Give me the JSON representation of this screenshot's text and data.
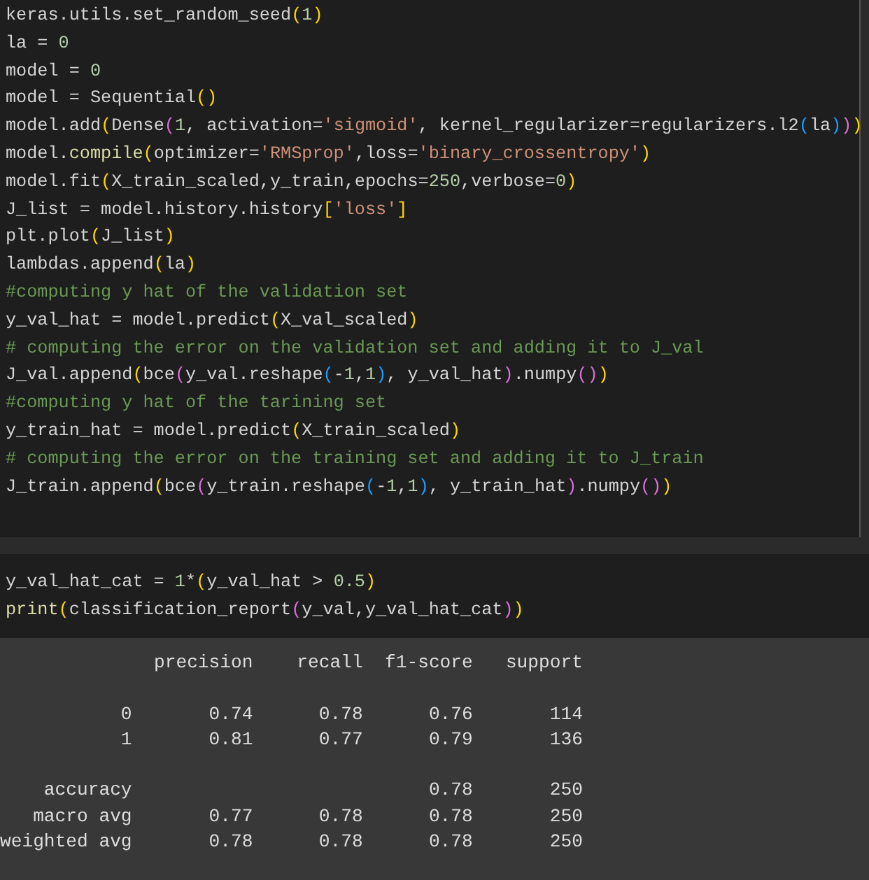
{
  "cells": [
    {
      "lines": [
        [
          {
            "kind": "plain",
            "text": "keras.utils.set_random_seed"
          },
          {
            "kind": "br1",
            "text": "("
          },
          {
            "kind": "num",
            "text": "1"
          },
          {
            "kind": "br1",
            "text": ")"
          }
        ],
        [
          {
            "kind": "plain",
            "text": "la = "
          },
          {
            "kind": "num",
            "text": "0"
          }
        ],
        [
          {
            "kind": "plain",
            "text": "model = "
          },
          {
            "kind": "num",
            "text": "0"
          }
        ],
        [
          {
            "kind": "plain",
            "text": "model = Sequential"
          },
          {
            "kind": "br1",
            "text": "()"
          }
        ],
        [
          {
            "kind": "plain",
            "text": "model.add"
          },
          {
            "kind": "br1",
            "text": "("
          },
          {
            "kind": "plain",
            "text": "Dense"
          },
          {
            "kind": "br2",
            "text": "("
          },
          {
            "kind": "num",
            "text": "1"
          },
          {
            "kind": "plain",
            "text": ", activation="
          },
          {
            "kind": "str",
            "text": "'sigmoid'"
          },
          {
            "kind": "plain",
            "text": ", kernel_regularizer=regularizers.l2"
          },
          {
            "kind": "br3",
            "text": "("
          },
          {
            "kind": "plain",
            "text": "la"
          },
          {
            "kind": "br3",
            "text": ")"
          },
          {
            "kind": "br2",
            "text": ")"
          },
          {
            "kind": "br1",
            "text": ")"
          }
        ],
        [
          {
            "kind": "plain",
            "text": "model."
          },
          {
            "kind": "fn",
            "text": "compile"
          },
          {
            "kind": "br1",
            "text": "("
          },
          {
            "kind": "plain",
            "text": "optimizer="
          },
          {
            "kind": "str",
            "text": "'RMSprop'"
          },
          {
            "kind": "plain",
            "text": ",loss="
          },
          {
            "kind": "str",
            "text": "'binary_crossentropy'"
          },
          {
            "kind": "br1",
            "text": ")"
          }
        ],
        [
          {
            "kind": "plain",
            "text": "model.fit"
          },
          {
            "kind": "br1",
            "text": "("
          },
          {
            "kind": "plain",
            "text": "X_train_scaled,y_train,epochs="
          },
          {
            "kind": "num",
            "text": "250"
          },
          {
            "kind": "plain",
            "text": ",verbose="
          },
          {
            "kind": "num",
            "text": "0"
          },
          {
            "kind": "br1",
            "text": ")"
          }
        ],
        [
          {
            "kind": "plain",
            "text": "J_list = model.history.history"
          },
          {
            "kind": "br1",
            "text": "["
          },
          {
            "kind": "str",
            "text": "'loss'"
          },
          {
            "kind": "br1",
            "text": "]"
          }
        ],
        [
          {
            "kind": "plain",
            "text": "plt.plot"
          },
          {
            "kind": "br1",
            "text": "("
          },
          {
            "kind": "plain",
            "text": "J_list"
          },
          {
            "kind": "br1",
            "text": ")"
          }
        ],
        [
          {
            "kind": "plain",
            "text": "lambdas.append"
          },
          {
            "kind": "br1",
            "text": "("
          },
          {
            "kind": "plain",
            "text": "la"
          },
          {
            "kind": "br1",
            "text": ")"
          }
        ],
        [
          {
            "kind": "com",
            "text": "#computing y hat of the validation set"
          }
        ],
        [
          {
            "kind": "plain",
            "text": "y_val_hat = model.predict"
          },
          {
            "kind": "br1",
            "text": "("
          },
          {
            "kind": "plain",
            "text": "X_val_scaled"
          },
          {
            "kind": "br1",
            "text": ")"
          }
        ],
        [
          {
            "kind": "com",
            "text": "# computing the error on the validation set and adding it to J_val"
          }
        ],
        [
          {
            "kind": "plain",
            "text": "J_val.append"
          },
          {
            "kind": "br1",
            "text": "("
          },
          {
            "kind": "plain",
            "text": "bce"
          },
          {
            "kind": "br2",
            "text": "("
          },
          {
            "kind": "plain",
            "text": "y_val.reshape"
          },
          {
            "kind": "br3",
            "text": "("
          },
          {
            "kind": "plain",
            "text": "-"
          },
          {
            "kind": "num",
            "text": "1"
          },
          {
            "kind": "plain",
            "text": ","
          },
          {
            "kind": "num",
            "text": "1"
          },
          {
            "kind": "br3",
            "text": ")"
          },
          {
            "kind": "plain",
            "text": ", y_val_hat"
          },
          {
            "kind": "br2",
            "text": ")"
          },
          {
            "kind": "plain",
            "text": ".numpy"
          },
          {
            "kind": "br2",
            "text": "()"
          },
          {
            "kind": "br1",
            "text": ")"
          }
        ],
        [
          {
            "kind": "com",
            "text": "#computing y hat of the tarining set"
          }
        ],
        [
          {
            "kind": "plain",
            "text": "y_train_hat = model.predict"
          },
          {
            "kind": "br1",
            "text": "("
          },
          {
            "kind": "plain",
            "text": "X_train_scaled"
          },
          {
            "kind": "br1",
            "text": ")"
          }
        ],
        [
          {
            "kind": "com",
            "text": "# computing the error on the training set and adding it to J_train"
          }
        ],
        [
          {
            "kind": "plain",
            "text": "J_train.append"
          },
          {
            "kind": "br1",
            "text": "("
          },
          {
            "kind": "plain",
            "text": "bce"
          },
          {
            "kind": "br2",
            "text": "("
          },
          {
            "kind": "plain",
            "text": "y_train.reshape"
          },
          {
            "kind": "br3",
            "text": "("
          },
          {
            "kind": "plain",
            "text": "-"
          },
          {
            "kind": "num",
            "text": "1"
          },
          {
            "kind": "plain",
            "text": ","
          },
          {
            "kind": "num",
            "text": "1"
          },
          {
            "kind": "br3",
            "text": ")"
          },
          {
            "kind": "plain",
            "text": ", y_train_hat"
          },
          {
            "kind": "br2",
            "text": ")"
          },
          {
            "kind": "plain",
            "text": ".numpy"
          },
          {
            "kind": "br2",
            "text": "()"
          },
          {
            "kind": "br1",
            "text": ")"
          }
        ]
      ]
    },
    {
      "lines": [
        [
          {
            "kind": "plain",
            "text": "y_val_hat_cat = "
          },
          {
            "kind": "num",
            "text": "1"
          },
          {
            "kind": "plain",
            "text": "*"
          },
          {
            "kind": "br1",
            "text": "("
          },
          {
            "kind": "plain",
            "text": "y_val_hat > "
          },
          {
            "kind": "num",
            "text": "0.5"
          },
          {
            "kind": "br1",
            "text": ")"
          }
        ],
        [
          {
            "kind": "fn",
            "text": "print"
          },
          {
            "kind": "br1",
            "text": "("
          },
          {
            "kind": "plain",
            "text": "classification_report"
          },
          {
            "kind": "br2",
            "text": "("
          },
          {
            "kind": "plain",
            "text": "y_val,y_val_hat_cat"
          },
          {
            "kind": "br2",
            "text": ")"
          },
          {
            "kind": "br1",
            "text": ")"
          }
        ]
      ],
      "output": [
        [
          "              precision    recall  f1-score   support"
        ],
        [
          "           0       0.74      0.78      0.76       114",
          "           1       0.81      0.77      0.79       136"
        ],
        [
          "    accuracy                           0.78       250",
          "   macro avg       0.77      0.78      0.78       250",
          "weighted avg       0.78      0.78      0.78       250"
        ]
      ]
    }
  ]
}
